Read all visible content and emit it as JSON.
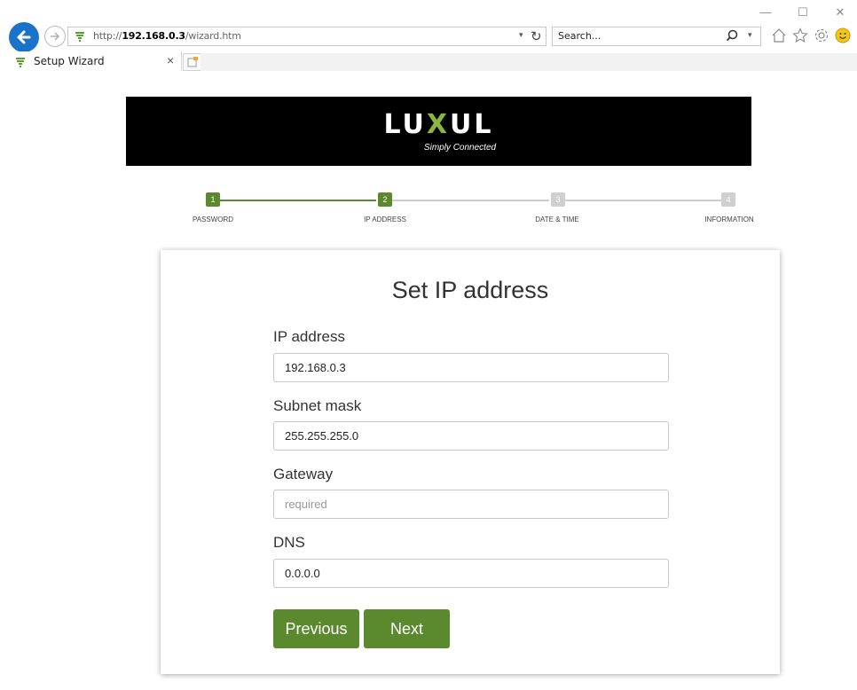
{
  "browser": {
    "url_prefix": "http://",
    "url_host": "192.168.0.3",
    "url_path": "/wizard.htm",
    "search_placeholder": "Search...",
    "tab_title": "Setup Wizard",
    "window_controls": {
      "minimize": "—",
      "maximize": "☐",
      "close": "✕"
    },
    "tab_close": "×",
    "dropdown_arrow": "▾",
    "refresh": "↻",
    "accent_color": "#1a73c8"
  },
  "banner": {
    "logo_pre": "LU",
    "logo_x": "X",
    "logo_post": "UL",
    "tagline": "Simply Connected"
  },
  "steps": [
    {
      "number": "1",
      "label": "PASSWORD",
      "state": "active"
    },
    {
      "number": "2",
      "label": "IP ADDRESS",
      "state": "active"
    },
    {
      "number": "3",
      "label": "DATE & TIME",
      "state": "inactive"
    },
    {
      "number": "4",
      "label": "INFORMATION",
      "state": "inactive"
    }
  ],
  "form": {
    "title": "Set IP address",
    "fields": [
      {
        "label": "IP address",
        "value": "192.168.0.3",
        "placeholder": ""
      },
      {
        "label": "Subnet mask",
        "value": "255.255.255.0",
        "placeholder": ""
      },
      {
        "label": "Gateway",
        "value": "",
        "placeholder": "required"
      },
      {
        "label": "DNS",
        "value": "0.0.0.0",
        "placeholder": ""
      }
    ],
    "previous_label": "Previous",
    "next_label": "Next",
    "button_color": "#5b8a2e"
  }
}
